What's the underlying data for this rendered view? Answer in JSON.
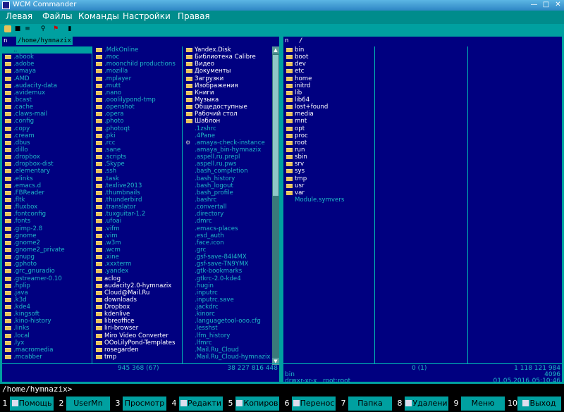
{
  "window": {
    "title": "WCM Commander"
  },
  "menu": [
    "Левая",
    "Файлы",
    "Команды",
    "Настройки",
    "Правая"
  ],
  "toolbar": [
    "drive-icon",
    "panel-icon",
    "compare-icon",
    "search-icon",
    "flag-icon",
    "info-icon"
  ],
  "left_panel": {
    "n": "n",
    "path": "/home/hymnazix",
    "col1": [
      {
        "name": "..",
        "type": "sel"
      },
      {
        "name": ".abook",
        "type": "dir"
      },
      {
        "name": ".adobe",
        "type": "dir"
      },
      {
        "name": ".amaya",
        "type": "dir"
      },
      {
        "name": ".AMD",
        "type": "dir"
      },
      {
        "name": ".audacity-data",
        "type": "dir"
      },
      {
        "name": ".avidemux",
        "type": "dir"
      },
      {
        "name": ".bcast",
        "type": "dir"
      },
      {
        "name": ".cache",
        "type": "dir"
      },
      {
        "name": ".claws-mail",
        "type": "dir"
      },
      {
        "name": ".config",
        "type": "dir"
      },
      {
        "name": ".copy",
        "type": "dir"
      },
      {
        "name": ".cream",
        "type": "dir"
      },
      {
        "name": ".dbus",
        "type": "dir"
      },
      {
        "name": ".dillo",
        "type": "dir"
      },
      {
        "name": ".dropbox",
        "type": "dir"
      },
      {
        "name": ".dropbox-dist",
        "type": "dir"
      },
      {
        "name": ".elementary",
        "type": "dir"
      },
      {
        "name": ".elinks",
        "type": "dir"
      },
      {
        "name": ".emacs.d",
        "type": "dir"
      },
      {
        "name": ".FBReader",
        "type": "dir"
      },
      {
        "name": ".fltk",
        "type": "dir"
      },
      {
        "name": ".fluxbox",
        "type": "dir"
      },
      {
        "name": ".fontconfig",
        "type": "dir"
      },
      {
        "name": ".fonts",
        "type": "dir"
      },
      {
        "name": ".gimp-2.8",
        "type": "dir"
      },
      {
        "name": ".gnome",
        "type": "dir"
      },
      {
        "name": ".gnome2",
        "type": "dir"
      },
      {
        "name": ".gnome2_private",
        "type": "dir"
      },
      {
        "name": ".gnupg",
        "type": "dir"
      },
      {
        "name": ".gphoto",
        "type": "dir"
      },
      {
        "name": ".grc_gnuradio",
        "type": "dir"
      },
      {
        "name": ".gstreamer-0.10",
        "type": "dir"
      },
      {
        "name": ".hplip",
        "type": "dir"
      },
      {
        "name": ".java",
        "type": "dir"
      },
      {
        "name": ".k3d",
        "type": "dir"
      },
      {
        "name": ".kde4",
        "type": "dir"
      },
      {
        "name": ".kingsoft",
        "type": "dir"
      },
      {
        "name": ".kino-history",
        "type": "dir"
      },
      {
        "name": ".links",
        "type": "dir"
      },
      {
        "name": ".local",
        "type": "dir"
      },
      {
        "name": ".lyx",
        "type": "dir"
      },
      {
        "name": ".macromedia",
        "type": "dir"
      },
      {
        "name": ".mcabber",
        "type": "dir"
      }
    ],
    "col2": [
      {
        "name": ".MdkOnline",
        "type": "dir"
      },
      {
        "name": ".moc",
        "type": "dir"
      },
      {
        "name": ".moonchild productions",
        "type": "dir"
      },
      {
        "name": ".mozilla",
        "type": "dir"
      },
      {
        "name": ".mplayer",
        "type": "dir"
      },
      {
        "name": ".mutt",
        "type": "dir"
      },
      {
        "name": ".nano",
        "type": "dir"
      },
      {
        "name": ".ooolilypond-tmp",
        "type": "dir"
      },
      {
        "name": ".openshot",
        "type": "dir"
      },
      {
        "name": ".opera",
        "type": "dir"
      },
      {
        "name": ".photo",
        "type": "dir"
      },
      {
        "name": ".photoqt",
        "type": "dir"
      },
      {
        "name": ".pki",
        "type": "dir"
      },
      {
        "name": ".rcc",
        "type": "dir"
      },
      {
        "name": ".sane",
        "type": "dir"
      },
      {
        "name": ".scripts",
        "type": "dir"
      },
      {
        "name": ".Skype",
        "type": "dir"
      },
      {
        "name": ".ssh",
        "type": "dir"
      },
      {
        "name": ".task",
        "type": "dir"
      },
      {
        "name": ".texlive2013",
        "type": "dir"
      },
      {
        "name": ".thumbnails",
        "type": "dir"
      },
      {
        "name": ".thunderbird",
        "type": "dir"
      },
      {
        "name": ".translator",
        "type": "dir"
      },
      {
        "name": ".tuxguitar-1.2",
        "type": "dir"
      },
      {
        "name": ".ufoai",
        "type": "dir"
      },
      {
        "name": ".vifm",
        "type": "dir"
      },
      {
        "name": ".vim",
        "type": "dir"
      },
      {
        "name": ".w3m",
        "type": "dir"
      },
      {
        "name": ".wcm",
        "type": "dir"
      },
      {
        "name": ".xine",
        "type": "dir"
      },
      {
        "name": ".xxxterm",
        "type": "dir"
      },
      {
        "name": ".yandex",
        "type": "dir"
      },
      {
        "name": "aclog",
        "type": "wdir"
      },
      {
        "name": "audacity2.0-hymnazix",
        "type": "wdir"
      },
      {
        "name": "Cloud@Mail.Ru",
        "type": "wdir"
      },
      {
        "name": "downloads",
        "type": "wdir"
      },
      {
        "name": "Dropbox",
        "type": "wdir"
      },
      {
        "name": "kdenlive",
        "type": "wdir"
      },
      {
        "name": "libreoffice",
        "type": "wdir"
      },
      {
        "name": "liri-browser",
        "type": "wdir"
      },
      {
        "name": "Miro Video Converter",
        "type": "wdir"
      },
      {
        "name": "OOoLilyPond-Templates",
        "type": "wdir"
      },
      {
        "name": "rosegarden",
        "type": "wdir"
      },
      {
        "name": "tmp",
        "type": "wdir"
      }
    ],
    "col3": [
      {
        "name": "Yandex.Disk",
        "type": "wdir"
      },
      {
        "name": "Библиотека Calibre",
        "type": "wdir"
      },
      {
        "name": "Видео",
        "type": "wdir"
      },
      {
        "name": "Документы",
        "type": "wdir"
      },
      {
        "name": "Загрузки",
        "type": "wdir"
      },
      {
        "name": "Изображения",
        "type": "wdir"
      },
      {
        "name": "Книги",
        "type": "wdir"
      },
      {
        "name": "Музыка",
        "type": "wdir"
      },
      {
        "name": "Общедоступные",
        "type": "wdir"
      },
      {
        "name": "Рабочий стол",
        "type": "wdir"
      },
      {
        "name": "Шаблон",
        "type": "wdir"
      },
      {
        "name": ".1zshrc",
        "type": "file"
      },
      {
        "name": ".4Pane",
        "type": "file"
      },
      {
        "name": ".amaya-check-instance",
        "type": "gear"
      },
      {
        "name": ".amaya_bin-hymnazix",
        "type": "file"
      },
      {
        "name": ".aspell.ru.prepl",
        "type": "file"
      },
      {
        "name": ".aspell.ru.pws",
        "type": "file"
      },
      {
        "name": ".bash_completion",
        "type": "file"
      },
      {
        "name": ".bash_history",
        "type": "file"
      },
      {
        "name": ".bash_logout",
        "type": "file"
      },
      {
        "name": ".bash_profile",
        "type": "file"
      },
      {
        "name": ".bashrc",
        "type": "file"
      },
      {
        "name": ".convertall",
        "type": "file"
      },
      {
        "name": ".directory",
        "type": "file"
      },
      {
        "name": ".dmrc",
        "type": "file"
      },
      {
        "name": ".emacs-places",
        "type": "file"
      },
      {
        "name": ".esd_auth",
        "type": "file"
      },
      {
        "name": ".face.icon",
        "type": "file"
      },
      {
        "name": ".grc",
        "type": "file"
      },
      {
        "name": ".gsf-save-84I4MX",
        "type": "file"
      },
      {
        "name": ".gsf-save-TN9YMX",
        "type": "file"
      },
      {
        "name": ".gtk-bookmarks",
        "type": "file"
      },
      {
        "name": ".gtkrc-2.0-kde4",
        "type": "file"
      },
      {
        "name": ".hugin",
        "type": "file"
      },
      {
        "name": ".inputrc",
        "type": "file"
      },
      {
        "name": ".inputrc.save",
        "type": "file"
      },
      {
        "name": ".jackdrc",
        "type": "file"
      },
      {
        "name": ".kinorc",
        "type": "file"
      },
      {
        "name": ".languagetool-ooo.cfg",
        "type": "file"
      },
      {
        "name": ".lesshst",
        "type": "file"
      },
      {
        "name": ".lfm_history",
        "type": "file"
      },
      {
        "name": ".lfmrc",
        "type": "file"
      },
      {
        "name": ".Mail.Ru_Cloud",
        "type": "file"
      },
      {
        "name": ".Mail.Ru_Cloud-hymnazix",
        "type": "file"
      }
    ],
    "status_count": "945 368 (67)",
    "status_size": "38 227 816 448"
  },
  "right_panel": {
    "n": "n",
    "path": "/",
    "col1": [
      {
        "name": "bin",
        "type": "wdir"
      },
      {
        "name": "boot",
        "type": "wdir"
      },
      {
        "name": "dev",
        "type": "wdir"
      },
      {
        "name": "etc",
        "type": "wdir"
      },
      {
        "name": "home",
        "type": "wdir"
      },
      {
        "name": "initrd",
        "type": "wdir"
      },
      {
        "name": "lib",
        "type": "wdir"
      },
      {
        "name": "lib64",
        "type": "wdir"
      },
      {
        "name": "lost+found",
        "type": "wdir"
      },
      {
        "name": "media",
        "type": "wdir"
      },
      {
        "name": "mnt",
        "type": "wdir"
      },
      {
        "name": "opt",
        "type": "wdir"
      },
      {
        "name": "proc",
        "type": "wdir"
      },
      {
        "name": "root",
        "type": "wdir"
      },
      {
        "name": "run",
        "type": "wdir"
      },
      {
        "name": "sbin",
        "type": "wdir"
      },
      {
        "name": "srv",
        "type": "wdir"
      },
      {
        "name": "sys",
        "type": "wdir"
      },
      {
        "name": "tmp",
        "type": "wdir"
      },
      {
        "name": "usr",
        "type": "wdir"
      },
      {
        "name": "var",
        "type": "wdir"
      },
      {
        "name": "Module.symvers",
        "type": "file"
      }
    ],
    "status_count": "0 (1)",
    "status_size": "1 118 121 984",
    "sel_name": "bin",
    "sel_size": "4096",
    "sel_perms": "drwxr-xr-x",
    "sel_owner": "root:root",
    "sel_date": "01.05.2016",
    "sel_time": "05:10:46"
  },
  "command_line": "/home/hymnazix>",
  "fkeys": [
    {
      "num": "1",
      "label": "Помощь",
      "icon": "help-icon"
    },
    {
      "num": "2",
      "label": "UserMn",
      "icon": ""
    },
    {
      "num": "3",
      "label": "Просмотр",
      "icon": ""
    },
    {
      "num": "4",
      "label": "Редакти",
      "icon": "edit-icon"
    },
    {
      "num": "5",
      "label": "Копиров",
      "icon": "copy-icon"
    },
    {
      "num": "6",
      "label": "Перенос",
      "icon": "move-icon"
    },
    {
      "num": "7",
      "label": "Папка",
      "icon": ""
    },
    {
      "num": "8",
      "label": "Удалени",
      "icon": "delete-icon"
    },
    {
      "num": "9",
      "label": "Меню",
      "icon": ""
    },
    {
      "num": "10",
      "label": "Выход",
      "icon": "exit-icon"
    }
  ]
}
